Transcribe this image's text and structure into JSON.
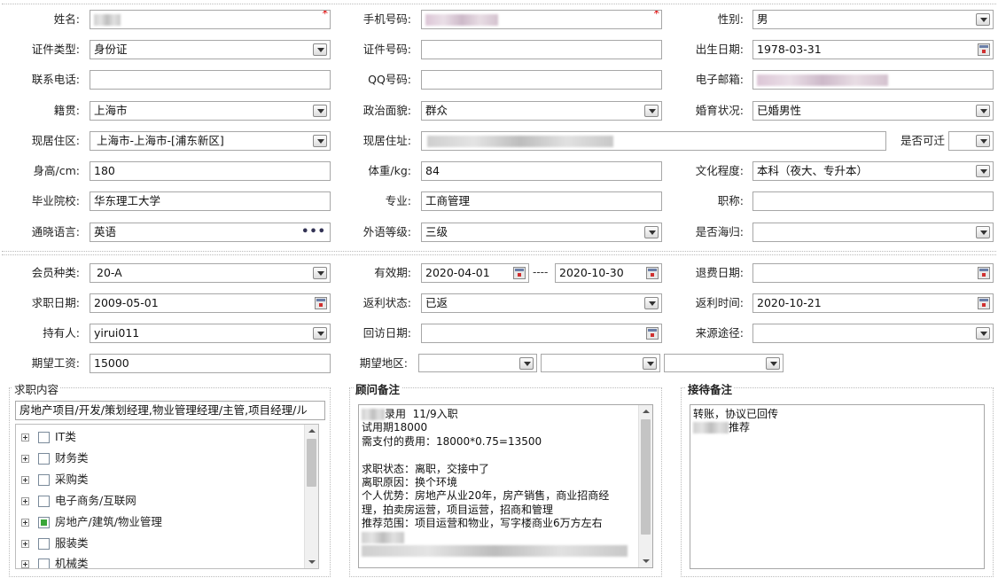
{
  "row1": {
    "name_label": "姓名:",
    "mobile_label": "手机号码:",
    "gender_label": "性别:",
    "gender": "男",
    "required": "*"
  },
  "row2": {
    "idtype_label": "证件类型:",
    "idtype": "身份证",
    "idno_label": "证件号码:",
    "birth_label": "出生日期:",
    "birth": "1978-03-31"
  },
  "row3": {
    "phone_label": "联系电话:",
    "qq_label": "QQ号码:",
    "email_label": "电子邮箱:"
  },
  "row4": {
    "native_label": "籍贯:",
    "native": "上海市",
    "political_label": "政治面貌:",
    "political": "群众",
    "marital_label": "婚育状况:",
    "marital": "已婚男性"
  },
  "row5": {
    "residence_label": "现居住区:",
    "residence": "上海市-上海市-[浦东新区]",
    "address_label": "现居住址:",
    "movable_label": "是否可迁"
  },
  "row6": {
    "height_label": "身高/cm:",
    "height": "180",
    "weight_label": "体重/kg:",
    "weight": "84",
    "edu_label": "文化程度:",
    "edu": "本科（夜大、专升本）"
  },
  "row7": {
    "school_label": "毕业院校:",
    "school": "华东理工大学",
    "major_label": "专业:",
    "major": "工商管理",
    "title_label": "职称:"
  },
  "row8": {
    "lang_label": "通晓语言:",
    "lang": "英语",
    "lang_more": "•••",
    "level_label": "外语等级:",
    "level": "三级",
    "abroad_label": "是否海归:"
  },
  "row9": {
    "member_label": "会员种类:",
    "member": "20-A",
    "valid_label": "有效期:",
    "valid_from": "2020-04-01",
    "valid_sep": "----",
    "valid_to": "2020-10-30",
    "refund_label": "退费日期:"
  },
  "row10": {
    "jobdate_label": "求职日期:",
    "jobdate": "2009-05-01",
    "rebate_label": "返利状态:",
    "rebate": "已返",
    "rebate_time_label": "返利时间:",
    "rebate_time": "2020-10-21"
  },
  "row11": {
    "holder_label": "持有人:",
    "holder": "yirui011",
    "visit_label": "回访日期:",
    "source_label": "来源途径:"
  },
  "row12": {
    "salary_label": "期望工资:",
    "salary": "15000",
    "area_label": "期望地区:"
  },
  "job": {
    "title": "求职内容",
    "summary": "房地产项目/开发/策划经理,物业管理经理/主管,项目经理/ル",
    "categories": [
      {
        "label": "IT类",
        "checked": false
      },
      {
        "label": "财务类",
        "checked": false
      },
      {
        "label": "采购类",
        "checked": false
      },
      {
        "label": "电子商务/互联网",
        "checked": false
      },
      {
        "label": "房地产/建筑/物业管理",
        "checked": true
      },
      {
        "label": "服装类",
        "checked": false
      },
      {
        "label": "机械类",
        "checked": false
      }
    ]
  },
  "advisor": {
    "title": "顾问备注",
    "line1": "录用  11/9入职",
    "line2": "试用期18000",
    "line3": "需支付的费用：18000*0.75=13500",
    "line4": "",
    "line5": "求职状态：离职，交接中了",
    "line6": "离职原因：换个环境",
    "line7": "个人优势：房地产从业20年，房产销售，商业招商经",
    "line8": "理，拍卖房运营，项目运营，招商和管理",
    "line9": "推荐范围：项目运营和物业，写字楼商业6万方左右"
  },
  "reception": {
    "title": "接待备注",
    "line1": "转账，协议已回传",
    "line2": "推荐"
  }
}
